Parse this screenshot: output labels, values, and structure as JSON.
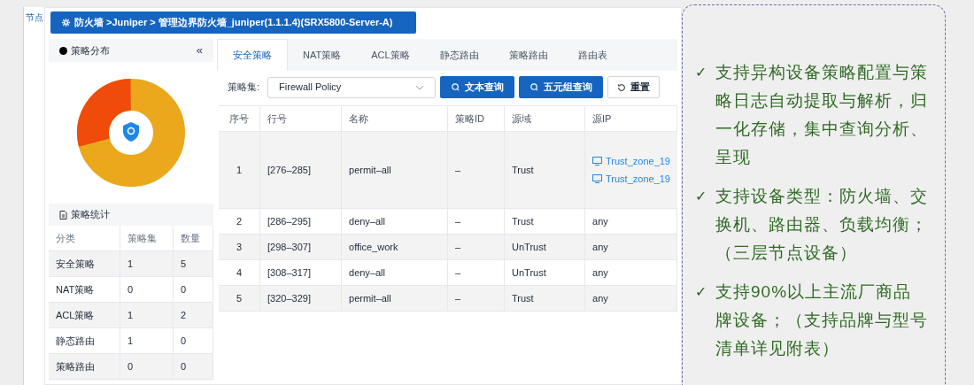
{
  "background_tab": "节点",
  "breadcrumb": "防火墙 >Juniper > 管理边界防火墙_juniper(1.1.1.4)(SRX5800-Server-A)",
  "distribution_panel": {
    "title": "策略分布",
    "collapse": "«"
  },
  "stats_panel": {
    "title": "策略统计",
    "columns": [
      "分类",
      "策略集",
      "数量"
    ],
    "rows": [
      [
        "安全策略",
        "1",
        "5"
      ],
      [
        "NAT策略",
        "0",
        "0"
      ],
      [
        "ACL策略",
        "1",
        "2"
      ],
      [
        "静态路由",
        "1",
        "0"
      ],
      [
        "策略路由",
        "0",
        "0"
      ]
    ]
  },
  "tabs": [
    {
      "label": "安全策略",
      "selected": true
    },
    {
      "label": "NAT策略",
      "selected": false
    },
    {
      "label": "ACL策略",
      "selected": false
    },
    {
      "label": "静态路由",
      "selected": false
    },
    {
      "label": "策略路由",
      "selected": false
    },
    {
      "label": "路由表",
      "selected": false
    }
  ],
  "filter": {
    "label": "策略集:",
    "value": "Firewall Policy",
    "buttons": [
      {
        "label": "文本查询",
        "kind": "primary"
      },
      {
        "label": "五元组查询",
        "kind": "primary"
      },
      {
        "label": "重置",
        "kind": "reset"
      }
    ]
  },
  "table": {
    "columns": [
      "序号",
      "行号",
      "名称",
      "策略ID",
      "源域",
      "源IP"
    ],
    "rows": [
      {
        "cells": [
          "1",
          "[276–285]",
          "permit–all",
          "–",
          "Trust"
        ],
        "source_ips": [
          "Trust_zone_19",
          "Trust_zone_19"
        ]
      },
      {
        "cells": [
          "2",
          "[286–295]",
          "deny–all",
          "–",
          "Trust",
          "any"
        ]
      },
      {
        "cells": [
          "3",
          "[298–307]",
          "office_work",
          "–",
          "UnTrust",
          "any"
        ]
      },
      {
        "cells": [
          "4",
          "[308–317]",
          "deny–all",
          "–",
          "UnTrust",
          "any"
        ]
      },
      {
        "cells": [
          "5",
          "[320–329]",
          "permit–all",
          "–",
          "Trust",
          "any"
        ]
      }
    ]
  },
  "features": [
    {
      "mark": "✓",
      "text": "支持异构设备策略配置与策略日志自动提取与解析，归一化存储，集中查询分析、呈现"
    },
    {
      "mark": "✓",
      "text": "支持设备类型：防火墙、交换机、路由器、负载均衡；（三层节点设备）"
    },
    {
      "mark": "✓",
      "text": "支持90%以上主流厂商品牌设备；（支持品牌与型号清单详见附表）"
    }
  ]
}
